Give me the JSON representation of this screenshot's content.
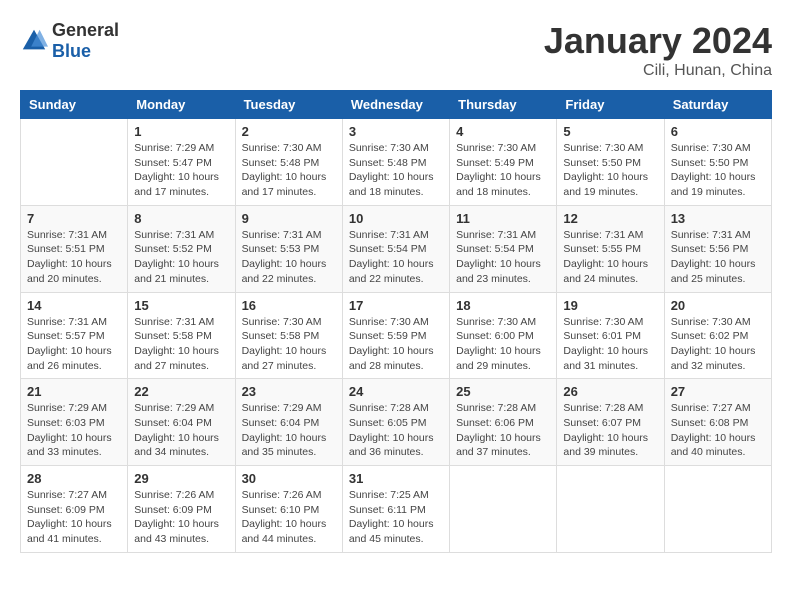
{
  "header": {
    "logo_general": "General",
    "logo_blue": "Blue",
    "month_year": "January 2024",
    "location": "Cili, Hunan, China"
  },
  "columns": [
    "Sunday",
    "Monday",
    "Tuesday",
    "Wednesday",
    "Thursday",
    "Friday",
    "Saturday"
  ],
  "weeks": [
    [
      {
        "day": "",
        "info": ""
      },
      {
        "day": "1",
        "info": "Sunrise: 7:29 AM\nSunset: 5:47 PM\nDaylight: 10 hours\nand 17 minutes."
      },
      {
        "day": "2",
        "info": "Sunrise: 7:30 AM\nSunset: 5:48 PM\nDaylight: 10 hours\nand 17 minutes."
      },
      {
        "day": "3",
        "info": "Sunrise: 7:30 AM\nSunset: 5:48 PM\nDaylight: 10 hours\nand 18 minutes."
      },
      {
        "day": "4",
        "info": "Sunrise: 7:30 AM\nSunset: 5:49 PM\nDaylight: 10 hours\nand 18 minutes."
      },
      {
        "day": "5",
        "info": "Sunrise: 7:30 AM\nSunset: 5:50 PM\nDaylight: 10 hours\nand 19 minutes."
      },
      {
        "day": "6",
        "info": "Sunrise: 7:30 AM\nSunset: 5:50 PM\nDaylight: 10 hours\nand 19 minutes."
      }
    ],
    [
      {
        "day": "7",
        "info": "Sunrise: 7:31 AM\nSunset: 5:51 PM\nDaylight: 10 hours\nand 20 minutes."
      },
      {
        "day": "8",
        "info": "Sunrise: 7:31 AM\nSunset: 5:52 PM\nDaylight: 10 hours\nand 21 minutes."
      },
      {
        "day": "9",
        "info": "Sunrise: 7:31 AM\nSunset: 5:53 PM\nDaylight: 10 hours\nand 22 minutes."
      },
      {
        "day": "10",
        "info": "Sunrise: 7:31 AM\nSunset: 5:54 PM\nDaylight: 10 hours\nand 22 minutes."
      },
      {
        "day": "11",
        "info": "Sunrise: 7:31 AM\nSunset: 5:54 PM\nDaylight: 10 hours\nand 23 minutes."
      },
      {
        "day": "12",
        "info": "Sunrise: 7:31 AM\nSunset: 5:55 PM\nDaylight: 10 hours\nand 24 minutes."
      },
      {
        "day": "13",
        "info": "Sunrise: 7:31 AM\nSunset: 5:56 PM\nDaylight: 10 hours\nand 25 minutes."
      }
    ],
    [
      {
        "day": "14",
        "info": "Sunrise: 7:31 AM\nSunset: 5:57 PM\nDaylight: 10 hours\nand 26 minutes."
      },
      {
        "day": "15",
        "info": "Sunrise: 7:31 AM\nSunset: 5:58 PM\nDaylight: 10 hours\nand 27 minutes."
      },
      {
        "day": "16",
        "info": "Sunrise: 7:30 AM\nSunset: 5:58 PM\nDaylight: 10 hours\nand 27 minutes."
      },
      {
        "day": "17",
        "info": "Sunrise: 7:30 AM\nSunset: 5:59 PM\nDaylight: 10 hours\nand 28 minutes."
      },
      {
        "day": "18",
        "info": "Sunrise: 7:30 AM\nSunset: 6:00 PM\nDaylight: 10 hours\nand 29 minutes."
      },
      {
        "day": "19",
        "info": "Sunrise: 7:30 AM\nSunset: 6:01 PM\nDaylight: 10 hours\nand 31 minutes."
      },
      {
        "day": "20",
        "info": "Sunrise: 7:30 AM\nSunset: 6:02 PM\nDaylight: 10 hours\nand 32 minutes."
      }
    ],
    [
      {
        "day": "21",
        "info": "Sunrise: 7:29 AM\nSunset: 6:03 PM\nDaylight: 10 hours\nand 33 minutes."
      },
      {
        "day": "22",
        "info": "Sunrise: 7:29 AM\nSunset: 6:04 PM\nDaylight: 10 hours\nand 34 minutes."
      },
      {
        "day": "23",
        "info": "Sunrise: 7:29 AM\nSunset: 6:04 PM\nDaylight: 10 hours\nand 35 minutes."
      },
      {
        "day": "24",
        "info": "Sunrise: 7:28 AM\nSunset: 6:05 PM\nDaylight: 10 hours\nand 36 minutes."
      },
      {
        "day": "25",
        "info": "Sunrise: 7:28 AM\nSunset: 6:06 PM\nDaylight: 10 hours\nand 37 minutes."
      },
      {
        "day": "26",
        "info": "Sunrise: 7:28 AM\nSunset: 6:07 PM\nDaylight: 10 hours\nand 39 minutes."
      },
      {
        "day": "27",
        "info": "Sunrise: 7:27 AM\nSunset: 6:08 PM\nDaylight: 10 hours\nand 40 minutes."
      }
    ],
    [
      {
        "day": "28",
        "info": "Sunrise: 7:27 AM\nSunset: 6:09 PM\nDaylight: 10 hours\nand 41 minutes."
      },
      {
        "day": "29",
        "info": "Sunrise: 7:26 AM\nSunset: 6:09 PM\nDaylight: 10 hours\nand 43 minutes."
      },
      {
        "day": "30",
        "info": "Sunrise: 7:26 AM\nSunset: 6:10 PM\nDaylight: 10 hours\nand 44 minutes."
      },
      {
        "day": "31",
        "info": "Sunrise: 7:25 AM\nSunset: 6:11 PM\nDaylight: 10 hours\nand 45 minutes."
      },
      {
        "day": "",
        "info": ""
      },
      {
        "day": "",
        "info": ""
      },
      {
        "day": "",
        "info": ""
      }
    ]
  ]
}
